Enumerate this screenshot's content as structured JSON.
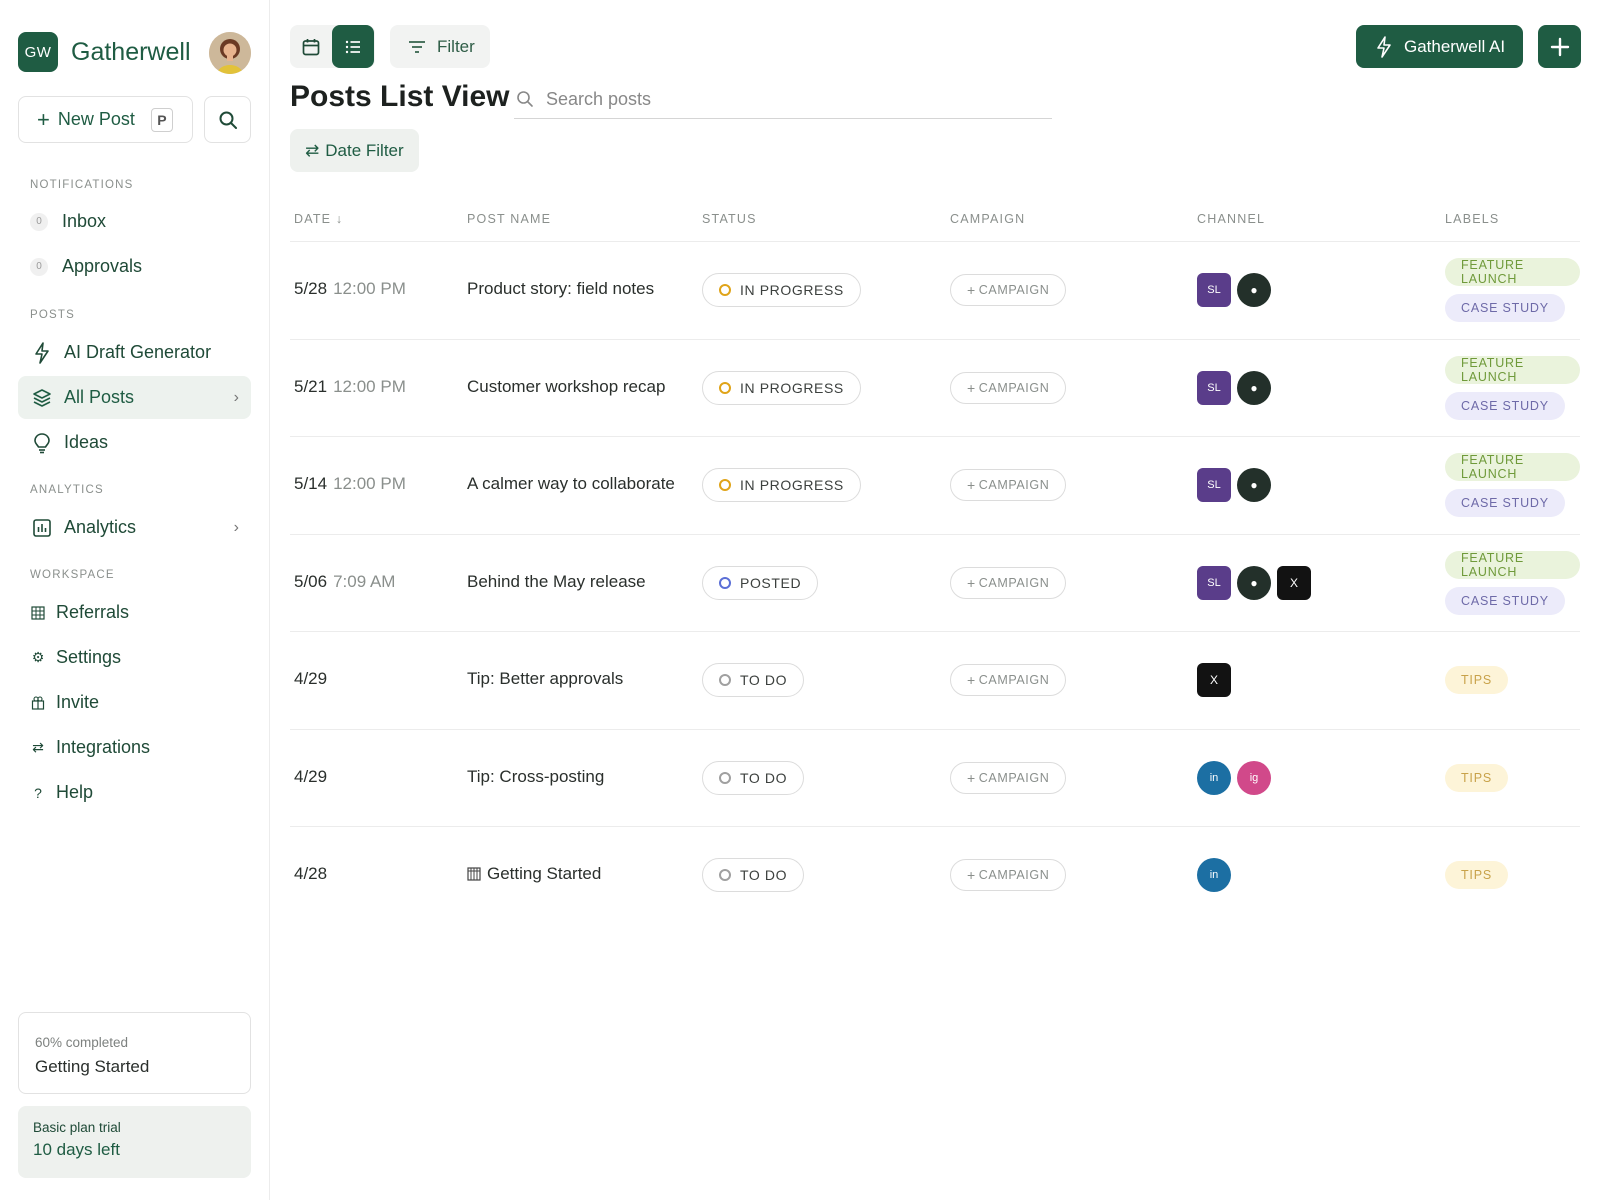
{
  "brand": {
    "logo_text": "GW",
    "name": "Gatherwell"
  },
  "sidebar": {
    "new_post_label": "New Post",
    "new_post_shortcut": "P",
    "sections": {
      "notifications": "NOTIFICATIONS",
      "posts": "POSTS",
      "analytics": "ANALYTICS",
      "workspace": "WORKSPACE"
    },
    "inbox": {
      "label": "Inbox",
      "count": "0"
    },
    "approvals": {
      "label": "Approvals",
      "count": "0"
    },
    "ai_draft": "AI Draft Generator",
    "all_posts": "All Posts",
    "ideas": "Ideas",
    "analytics": "Analytics",
    "referrals": "Referrals",
    "settings": "Settings",
    "invite": "Invite",
    "integrations": "Integrations",
    "help": "Help",
    "progress": {
      "percent_text": "60% completed",
      "title": "Getting Started"
    },
    "trial": {
      "plan": "Basic plan trial",
      "days_left": "10 days left"
    }
  },
  "toolbar": {
    "filter_label": "Filter",
    "ai_label": "Gatherwell AI"
  },
  "main": {
    "title": "Posts List View",
    "search_placeholder": "Search posts",
    "date_filter_label": "Date Filter"
  },
  "table": {
    "headers": {
      "date": "DATE",
      "post_name": "POST NAME",
      "status": "STATUS",
      "campaign": "CAMPAIGN",
      "channel": "CHANNEL",
      "labels": "LABELS"
    },
    "campaign_placeholder": "CAMPAIGN",
    "rows": [
      {
        "date": "5/28",
        "time": "12:00 PM",
        "name": "Product story: field notes",
        "status": "IN PROGRESS",
        "channels": [
          "SL",
          "●"
        ],
        "labels": [
          "FEATURE LAUNCH",
          "CASE STUDY"
        ]
      },
      {
        "date": "5/21",
        "time": "12:00 PM",
        "name": "Customer workshop recap",
        "status": "IN PROGRESS",
        "channels": [
          "SL",
          "●"
        ],
        "labels": [
          "FEATURE LAUNCH",
          "CASE STUDY"
        ]
      },
      {
        "date": "5/14",
        "time": "12:00 PM",
        "name": "A calmer way to collaborate",
        "status": "IN PROGRESS",
        "channels": [
          "SL",
          "●"
        ],
        "labels": [
          "FEATURE LAUNCH",
          "CASE STUDY"
        ]
      },
      {
        "date": "5/06",
        "time": "7:09 AM",
        "name": "Behind the May release",
        "status": "POSTED",
        "channels": [
          "SL",
          "●",
          "X"
        ],
        "labels": [
          "FEATURE LAUNCH",
          "CASE STUDY"
        ]
      },
      {
        "date": "4/29",
        "time": "",
        "name": "Tip: Better approvals",
        "status": "TO DO",
        "channels": [
          "X"
        ],
        "labels": [
          "TIPS"
        ]
      },
      {
        "date": "4/29",
        "time": "",
        "name": "Tip: Cross-posting",
        "status": "TO DO",
        "channels": [
          "in",
          "ig"
        ],
        "labels": [
          "TIPS"
        ]
      },
      {
        "date": "4/28",
        "time": "",
        "name": "Getting Started",
        "name_prefix_icon": "calendar-grid-icon",
        "status": "TO DO",
        "channels": [
          "in"
        ],
        "labels": [
          "TIPS"
        ]
      }
    ]
  },
  "colors": {
    "brand": "#1f5c43",
    "status_in_progress": "#e0a419",
    "status_posted": "#5b6fd6",
    "status_todo": "#a0a0a0",
    "label_feature_launch_bg": "#eaf3dc",
    "label_feature_launch_fg": "#6f9a3a",
    "label_case_study_bg": "#ecebfa",
    "label_case_study_fg": "#6e6aa8",
    "label_tips_bg": "#fdf4d8",
    "label_tips_fg": "#c8a24a"
  }
}
